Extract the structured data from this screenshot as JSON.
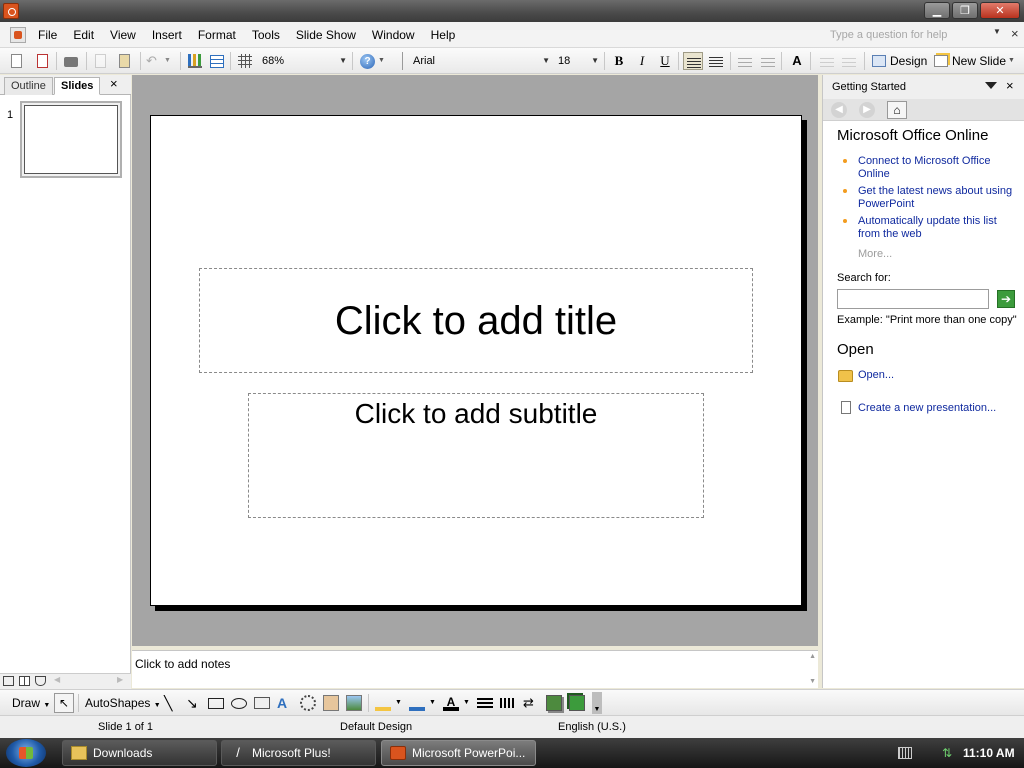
{
  "window": {
    "minimize_glyph": "▁",
    "restore_glyph": "❐",
    "close_glyph": "✕"
  },
  "menubar": {
    "items": [
      "File",
      "Edit",
      "View",
      "Insert",
      "Format",
      "Tools",
      "Slide Show",
      "Window",
      "Help"
    ],
    "help_placeholder": "Type a question for help",
    "close_glyph": "×"
  },
  "toolbar": {
    "zoom": "68%",
    "font_name": "Arial",
    "font_size": "18",
    "bold": "B",
    "italic": "I",
    "underline": "U",
    "grow_font": "A",
    "design_label": "Design",
    "new_slide_label": "New Slide",
    "help_glyph": "?"
  },
  "left_panel": {
    "tabs": [
      "Outline",
      "Slides"
    ],
    "active_tab": "Slides",
    "close_glyph": "×",
    "slides": [
      {
        "number": "1"
      }
    ]
  },
  "slide": {
    "title_placeholder": "Click to add title",
    "subtitle_placeholder": "Click to add subtitle"
  },
  "notes": {
    "placeholder": "Click to add notes"
  },
  "task_pane": {
    "title": "Getting Started",
    "close_glyph": "×",
    "home_glyph": "⌂",
    "online_heading": "Microsoft Office Online",
    "links": [
      "Connect to Microsoft Office Online",
      "Get the latest news about using PowerPoint",
      "Automatically update this list from the web"
    ],
    "more": "More...",
    "search_label": "Search for:",
    "search_value": "",
    "search_go_glyph": "➔",
    "example": "Example:  \"Print more than one copy\"",
    "open_heading": "Open",
    "open_link": "Open...",
    "create_link": "Create a new presentation..."
  },
  "drawing_toolbar": {
    "draw_label": "Draw",
    "autoshapes_label": "AutoShapes"
  },
  "statusbar": {
    "slide_position": "Slide 1 of 1",
    "design": "Default Design",
    "language": "English (U.S.)"
  },
  "taskbar": {
    "buttons": [
      {
        "label": "Downloads",
        "active": false
      },
      {
        "label": "Microsoft Plus!",
        "active": false
      },
      {
        "label": "Microsoft PowerPoi...",
        "active": true
      }
    ],
    "clock": "11:10 AM"
  },
  "colors": {
    "accent_orange": "#d9541e",
    "link_blue": "#102a9f",
    "bullet_orange": "#f29c1f",
    "edit_area_gray": "#a5a5a5"
  }
}
